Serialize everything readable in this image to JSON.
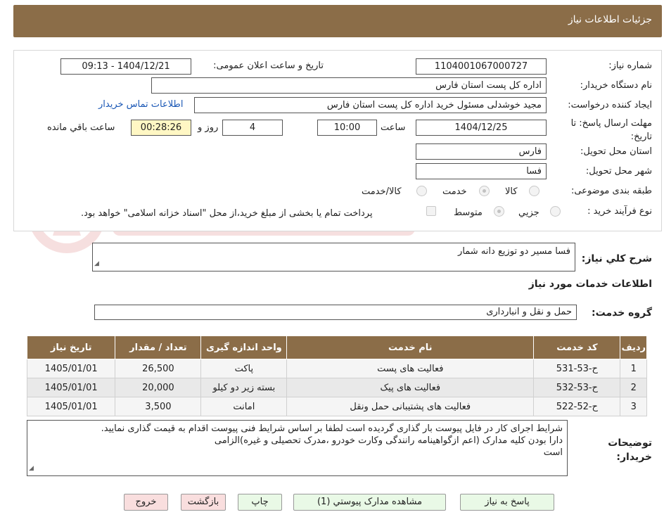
{
  "header": {
    "title": "جزئیات اطلاعات نیاز"
  },
  "form": {
    "need_number_label": "شماره نیاز:",
    "need_number": "1104001067000727",
    "announce_label": "تاریخ و ساعت اعلان عمومی:",
    "announce_value": "1404/12/21 - 09:13",
    "buyer_org_label": "نام دستگاه خریدار:",
    "buyer_org": "اداره کل پست استان فارس",
    "requester_label": "ایجاد کننده درخواست:",
    "requester": "مجید خوشدلی مسئول خرید اداره کل پست استان فارس",
    "buyer_contact_link": "اطلاعات تماس خریدار",
    "deadline_label": "مهلت ارسال پاسخ: تا تاریخ:",
    "deadline_date": "1404/12/25",
    "time_label": "ساعت",
    "deadline_time": "10:00",
    "days_value": "4",
    "days_label": "روز و",
    "remaining_time": "00:28:26",
    "remaining_label": "ساعت باقي مانده",
    "province_label": "استان محل تحویل:",
    "province": "فارس",
    "city_label": "شهر محل تحویل:",
    "city": "فسا",
    "category_label": "طبقه بندی موضوعی:",
    "category_options": [
      "کالا",
      "خدمت",
      "کالا/خدمت"
    ],
    "category_selected": "خدمت",
    "process_label": "نوع فرآیند خرید :",
    "process_options": [
      "جزيي",
      "متوسط"
    ],
    "process_selected": "متوسط",
    "payment_note": "پرداخت تمام یا بخشی از مبلغ خرید،از محل \"اسناد خزانه اسلامی\" خواهد بود."
  },
  "description": {
    "label": "شرح کلي نياز:",
    "value": "فسا مسیر دو توزیع دانه شمار"
  },
  "services_section": {
    "title": "اطلاعات خدمات مورد نياز"
  },
  "service_group": {
    "label": "گروه خدمت:",
    "value": "حمل و نقل و انبارداری"
  },
  "table": {
    "headers": [
      "ردیف",
      "کد خدمت",
      "نام خدمت",
      "واحد اندازه گیری",
      "تعداد / مقدار",
      "تاریخ نیاز"
    ],
    "rows": [
      [
        "1",
        "ح-53-531",
        "فعالیت های پست",
        "پاکت",
        "26,500",
        "1405/01/01"
      ],
      [
        "2",
        "ح-53-532",
        "فعالیت های پیک",
        "بسته زیر دو کیلو",
        "20,000",
        "1405/01/01"
      ],
      [
        "3",
        "ح-52-522",
        "فعالیت های پشتیبانی حمل ونقل",
        "امانت",
        "3,500",
        "1405/01/01"
      ]
    ]
  },
  "buyer_notes": {
    "label": "توضیحات خریدار:",
    "lines": [
      "شرایط اجرای کار در فایل پیوست بار گذاری گردیده است لطفا بر اساس شرایط فنی پیوست اقدام به قیمت گذاری نمایید.",
      "دارا بودن کلیه مدارک (اعم ازگواهینامه رانندگی وکارت خودرو ،مدرک تحصیلی و غیره)الزامی",
      "است"
    ]
  },
  "buttons": {
    "reply": "پاسخ به نیاز",
    "attachments": "مشاهده مدارک پیوستي (1)",
    "print": "چاپ",
    "back": "بازگشت",
    "exit": "خروج"
  },
  "colors": {
    "brand": "#8b6d48",
    "link": "#1a57b5",
    "timer_bg": "#fff7c4"
  }
}
